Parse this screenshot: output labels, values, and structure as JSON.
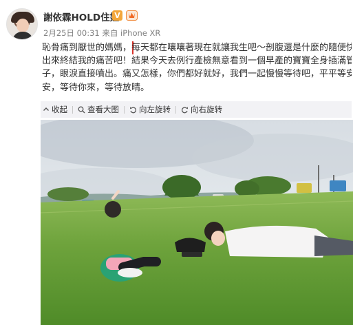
{
  "profile": {
    "username": "謝依霖HOLD住姐",
    "verified_badge": "V",
    "meta": "2月25日 00:31 来自 iPhone XR",
    "avatar_icon": "user-avatar"
  },
  "post": {
    "highlight": "恥骨痛到厭世的媽媽，",
    "line1_rest": "每天都在嚷嚷著現在就讓我生吧～剖腹還是什麼的隨便快",
    "line2": "出來終結我的痛苦吧！結果今天去例行產檢無意看到一個早產的寶寶全身插滿管",
    "line3": "子，眼淚直接噴出。痛又怎樣，你們都好就好，我們一起慢慢等待吧，平平等安",
    "line4": "安，等待你來，等待放晴。"
  },
  "toolbar": {
    "collapse": "收起",
    "view_large": "查看大图",
    "rotate_left": "向左旋转",
    "rotate_right": "向右旋转"
  },
  "colors": {
    "highlight_box": "#d9322a",
    "toolbar_bg": "#f2f2f5",
    "verified_badge": "#f3a63a"
  }
}
